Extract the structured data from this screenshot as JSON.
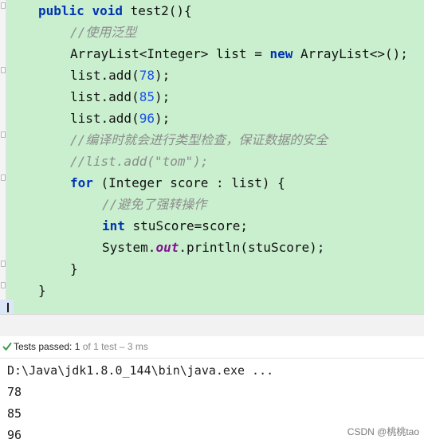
{
  "editor": {
    "lines": {
      "l1_kw1": "public",
      "l1_kw2": "void",
      "l1_rest": "test2(){",
      "l2_comment": "//使用泛型",
      "l3_type": "ArrayList<Integer> list = ",
      "l3_kw": "new",
      "l3_rest": "ArrayList<>();",
      "l4_call": "list.add(",
      "l4_num": "78",
      "l4_end": ");",
      "l5_call": "list.add(",
      "l5_num": "85",
      "l5_end": ");",
      "l6_call": "list.add(",
      "l6_num": "96",
      "l6_end": ");",
      "l7_comment": "//编译时就会进行类型检查，保证数据的安全",
      "l8_comment": "//list.add(\"tom\");",
      "l9_kw": "for",
      "l9_rest": " (Integer score : list) {",
      "l10_comment": "//避免了强转操作",
      "l11_kw": "int",
      "l11_rest": " stuScore=score;",
      "l12_pre": "System.",
      "l12_field": "out",
      "l12_rest": ".println(stuScore);",
      "l13": "}",
      "l14": "}"
    }
  },
  "test_status": {
    "icon": "check-icon",
    "passed_label": "Tests passed:",
    "passed_count": "1",
    "of_total": "of 1 test",
    "separator": "–",
    "duration": "3 ms"
  },
  "console": {
    "command": "D:\\Java\\jdk1.8.0_144\\bin\\java.exe ...",
    "outputs": [
      "78",
      "85",
      "96"
    ]
  },
  "watermark": "CSDN @桃桃tao",
  "colors": {
    "editor_bg": "#c9efce",
    "keyword": "#0033b3",
    "number": "#1750eb",
    "comment": "#8c8c8c",
    "field": "#871094",
    "pass_green": "#3a9a4a"
  }
}
